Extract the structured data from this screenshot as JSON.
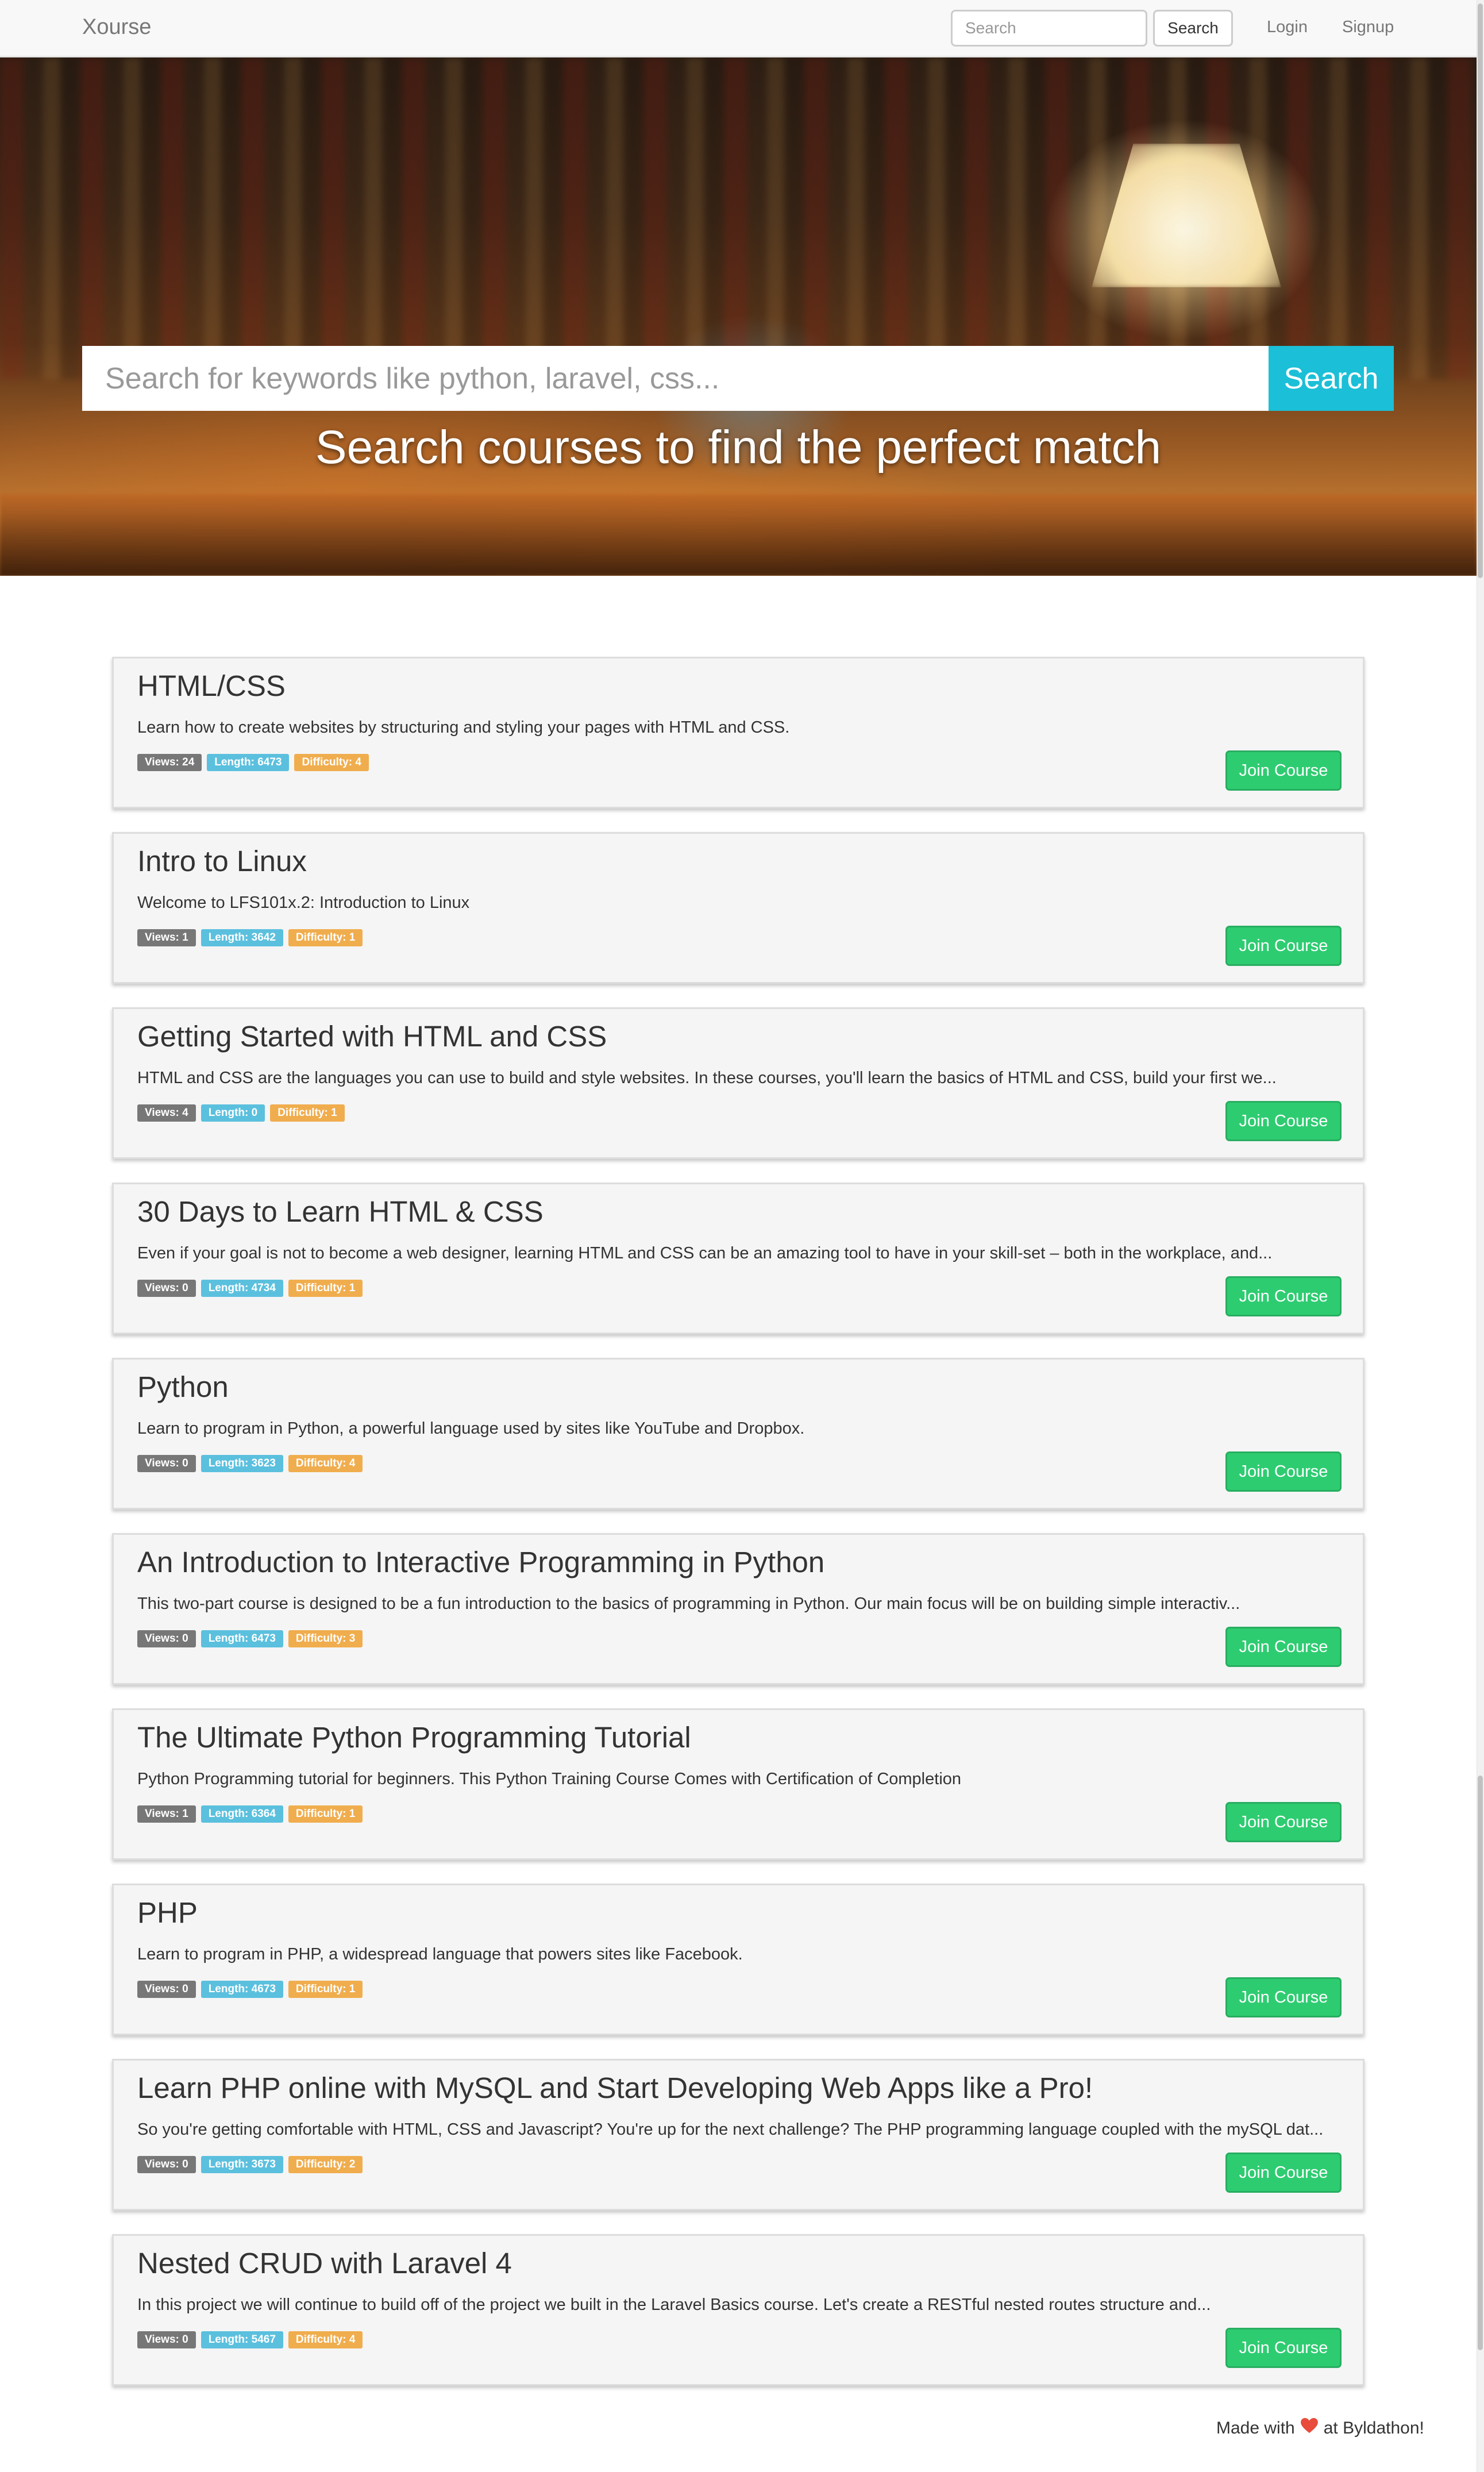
{
  "navbar": {
    "brand": "Xourse",
    "search_placeholder": "Search",
    "search_button": "Search",
    "login": "Login",
    "signup": "Signup"
  },
  "hero": {
    "search_placeholder": "Search for keywords like python, laravel, css...",
    "search_button": "Search",
    "title": "Search courses to find the perfect match"
  },
  "courses": [
    {
      "title": "HTML/CSS",
      "description": "Learn how to create websites by structuring and styling your pages with HTML and CSS.",
      "views": "Views: 24",
      "length": "Length: 6473",
      "difficulty": "Difficulty: 4",
      "button": "Join Course"
    },
    {
      "title": "Intro to Linux",
      "description": "Welcome to LFS101x.2: Introduction to Linux",
      "views": "Views: 1",
      "length": "Length: 3642",
      "difficulty": "Difficulty: 1",
      "button": "Join Course"
    },
    {
      "title": "Getting Started with HTML and CSS",
      "description": "HTML and CSS are the languages you can use to build and style websites. In these courses, you'll learn the basics of HTML and CSS, build your first we...",
      "views": "Views: 4",
      "length": "Length: 0",
      "difficulty": "Difficulty: 1",
      "button": "Join Course"
    },
    {
      "title": "30 Days to Learn HTML & CSS",
      "description": "Even if your goal is not to become a web designer, learning HTML and CSS can be an amazing tool to have in your skill-set – both in the workplace, and...",
      "views": "Views: 0",
      "length": "Length: 4734",
      "difficulty": "Difficulty: 1",
      "button": "Join Course"
    },
    {
      "title": "Python",
      "description": "Learn to program in Python, a powerful language used by sites like YouTube and Dropbox.",
      "views": "Views: 0",
      "length": "Length: 3623",
      "difficulty": "Difficulty: 4",
      "button": "Join Course"
    },
    {
      "title": "An Introduction to Interactive Programming in Python",
      "description": "This two-part course is designed to be a fun introduction to the basics of programming in Python. Our main focus will be on building simple interactiv...",
      "views": "Views: 0",
      "length": "Length: 6473",
      "difficulty": "Difficulty: 3",
      "button": "Join Course"
    },
    {
      "title": "The Ultimate Python Programming Tutorial",
      "description": "Python Programming tutorial for beginners. This Python Training Course Comes with Certification of Completion",
      "views": "Views: 1",
      "length": "Length: 6364",
      "difficulty": "Difficulty: 1",
      "button": "Join Course"
    },
    {
      "title": "PHP",
      "description": "Learn to program in PHP, a widespread language that powers sites like Facebook.",
      "views": "Views: 0",
      "length": "Length: 4673",
      "difficulty": "Difficulty: 1",
      "button": "Join Course"
    },
    {
      "title": "Learn PHP online with MySQL and Start Developing Web Apps like a Pro!",
      "description": "So you're getting comfortable with HTML, CSS and Javascript? You're up for the next challenge? The PHP programming language coupled with the mySQL dat...",
      "views": "Views: 0",
      "length": "Length: 3673",
      "difficulty": "Difficulty: 2",
      "button": "Join Course"
    },
    {
      "title": "Nested CRUD with Laravel 4",
      "description": "In this project we will continue to build off of the project we built in the Laravel Basics course. Let's create a RESTful nested routes structure and...",
      "views": "Views: 0",
      "length": "Length: 5467",
      "difficulty": "Difficulty: 4",
      "button": "Join Course"
    }
  ],
  "footer": {
    "made_with": "Made with",
    "heart_icon": "heart-icon",
    "at": "at Byldathon!"
  },
  "colors": {
    "accent_cyan": "#1bbfd7",
    "join_green": "#2ecc71",
    "badge_views": "#777777",
    "badge_length": "#5bc0de",
    "badge_difficulty": "#f0ad4e",
    "heart": "#e74c3c"
  }
}
